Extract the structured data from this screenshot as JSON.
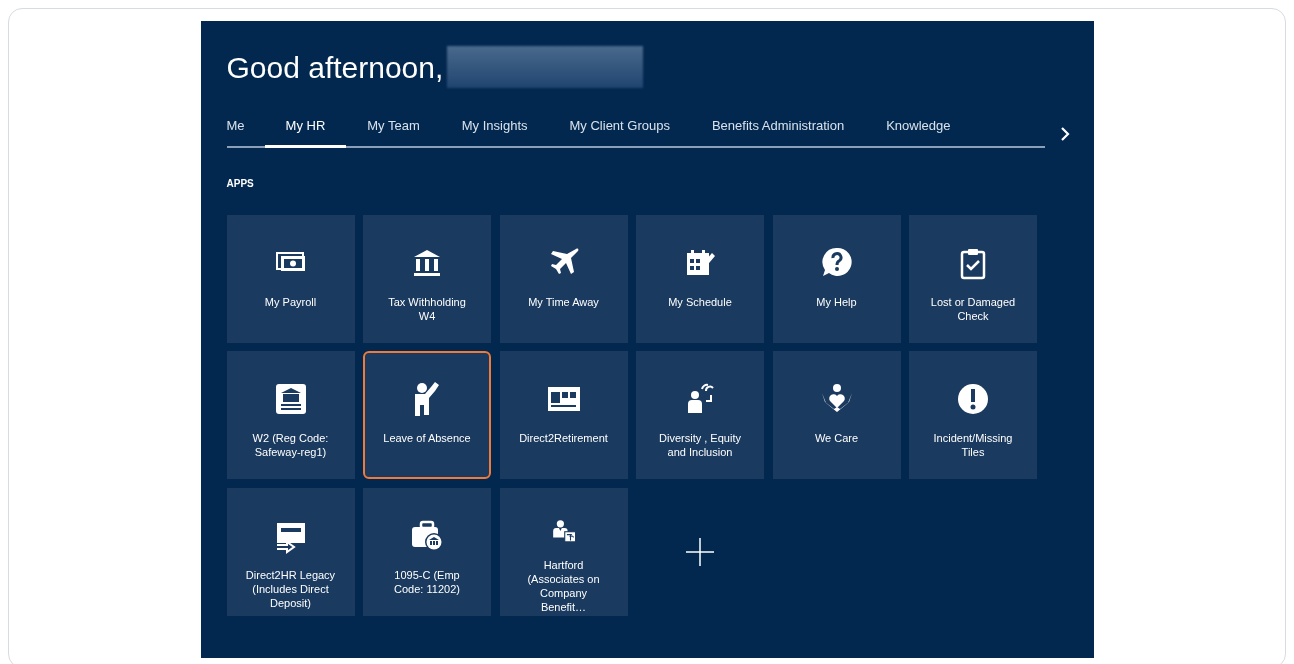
{
  "greeting": "Good afternoon,",
  "tabs": [
    {
      "label": "Me",
      "selected": false
    },
    {
      "label": "My HR",
      "selected": true
    },
    {
      "label": "My Team",
      "selected": false
    },
    {
      "label": "My Insights",
      "selected": false
    },
    {
      "label": "My Client Groups",
      "selected": false
    },
    {
      "label": "Benefits Administration",
      "selected": false
    },
    {
      "label": "Knowledge",
      "selected": false
    }
  ],
  "section_title": "APPS",
  "tiles": [
    {
      "kind": "app",
      "label": "My Payroll",
      "highlighted": false
    },
    {
      "kind": "app",
      "label": "Tax Withholding W4",
      "highlighted": false
    },
    {
      "kind": "app",
      "label": "My Time Away",
      "highlighted": false
    },
    {
      "kind": "app",
      "label": "My Schedule",
      "highlighted": false
    },
    {
      "kind": "app",
      "label": "My Help",
      "highlighted": false
    },
    {
      "kind": "app",
      "label": "Lost or Damaged Check",
      "highlighted": false
    },
    {
      "kind": "app",
      "label": "W2 (Reg Code: Safeway-reg1)",
      "highlighted": false
    },
    {
      "kind": "app",
      "label": "Leave of Absence",
      "highlighted": true
    },
    {
      "kind": "app",
      "label": "Direct2Retirement",
      "highlighted": false
    },
    {
      "kind": "app",
      "label": "Diversity , Equity and Inclusion",
      "highlighted": false
    },
    {
      "kind": "app",
      "label": "We Care",
      "highlighted": false
    },
    {
      "kind": "app",
      "label": "Incident/Missing Tiles",
      "highlighted": false
    },
    {
      "kind": "app",
      "label": "Direct2HR Legacy (Includes Direct Deposit)",
      "highlighted": false
    },
    {
      "kind": "app",
      "label": "1095-C (Emp Code: 11202)",
      "highlighted": false
    },
    {
      "kind": "app",
      "label": "Hartford (Associates on Company Benefit…",
      "highlighted": false
    },
    {
      "kind": "add"
    }
  ]
}
